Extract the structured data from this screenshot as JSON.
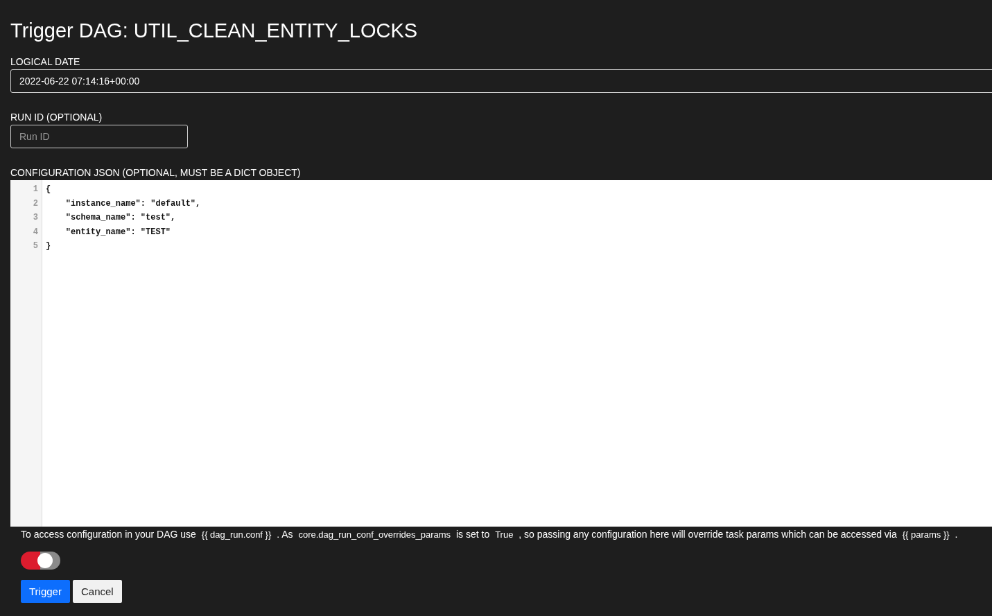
{
  "title": "Trigger DAG: UTIL_CLEAN_ENTITY_LOCKS",
  "logical_date": {
    "label": "LOGICAL DATE",
    "value": "2022-06-22 07:14:16+00:00"
  },
  "run_id": {
    "label": "RUN ID (OPTIONAL)",
    "placeholder": "Run ID"
  },
  "config": {
    "label": "CONFIGURATION JSON (OPTIONAL, MUST BE A DICT OBJECT)",
    "lines": [
      {
        "number": "1",
        "text": "{"
      },
      {
        "number": "2",
        "text": "    \"instance_name\": \"default\","
      },
      {
        "number": "3",
        "text": "    \"schema_name\": \"test\","
      },
      {
        "number": "4",
        "text": "    \"entity_name\": \"TEST\""
      },
      {
        "number": "5",
        "text": "}"
      }
    ]
  },
  "note": [
    {
      "kind": "text",
      "text": "To access configuration in your DAG use "
    },
    {
      "kind": "code",
      "text": "{{ dag_run.conf }}"
    },
    {
      "kind": "text",
      "text": " . As "
    },
    {
      "kind": "code",
      "text": "core.dag_run_conf_overrides_params"
    },
    {
      "kind": "text",
      "text": " is set to "
    },
    {
      "kind": "code",
      "text": "True"
    },
    {
      "kind": "text",
      "text": " , so passing any configuration here will override task params which can be accessed via "
    },
    {
      "kind": "code",
      "text": "{{ params }}"
    },
    {
      "kind": "text",
      "text": " ."
    }
  ],
  "toggle": {
    "on": false
  },
  "buttons": [
    {
      "label": "Trigger",
      "kind": "primary"
    },
    {
      "label": "Cancel",
      "kind": "secondary"
    }
  ]
}
